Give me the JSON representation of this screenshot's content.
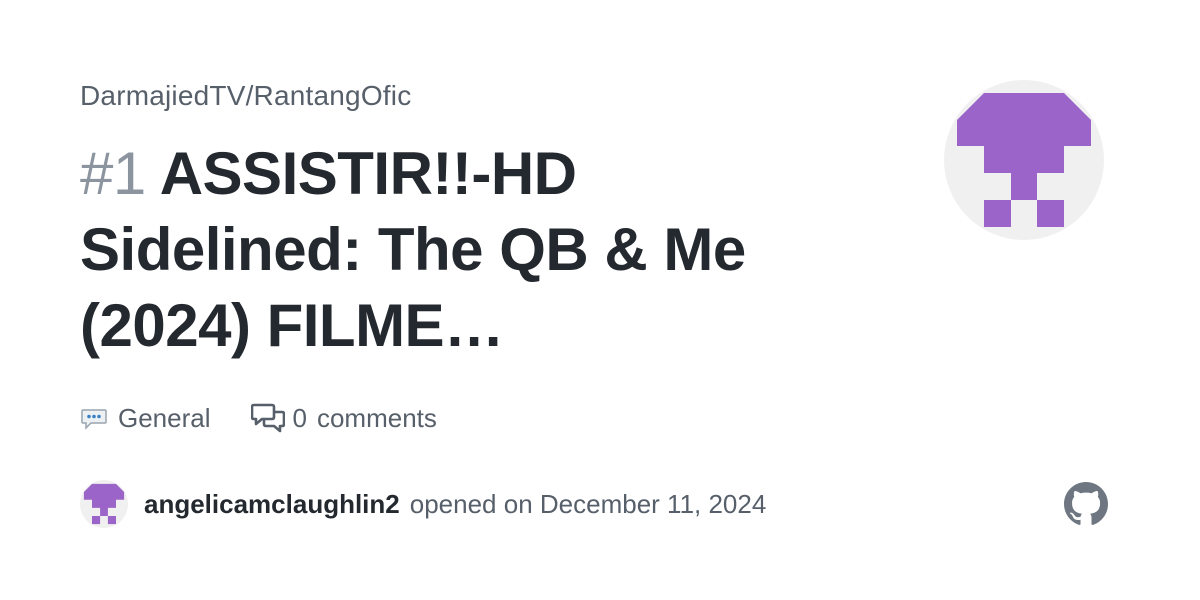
{
  "repo": "DarmajiedTV/RantangOfic",
  "issue": {
    "number": "#1",
    "title": "ASSISTIR!!-HD Sidelined: The QB & Me (2024) FILME…"
  },
  "meta": {
    "category": "General",
    "category_icon": "speech-balloon-icon",
    "comments_count": "0",
    "comments_label": "comments",
    "comments_icon": "comment-discussion-icon"
  },
  "author": {
    "username": "angelicamclaughlin2",
    "opened_text": "opened on December 11, 2024"
  },
  "brand_icon": "github-icon",
  "colors": {
    "avatar_purple": "#9b64c8",
    "avatar_bg": "#f0f0f0",
    "text_primary": "#24292f",
    "text_secondary": "#57606a",
    "number_gray": "#8c959f"
  }
}
